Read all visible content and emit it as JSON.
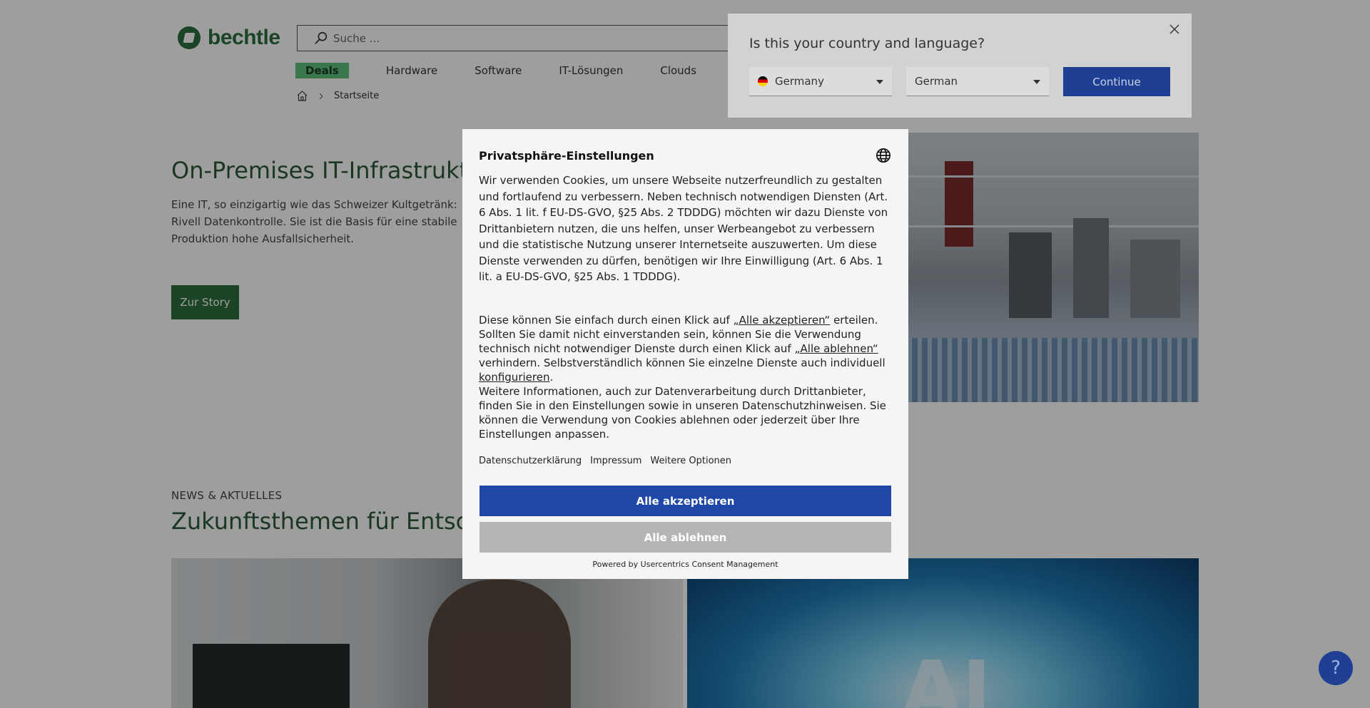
{
  "header": {
    "logo_text": "bechtle",
    "search_placeholder": "Suche ...",
    "nav": [
      "Deals",
      "Hardware",
      "Software",
      "IT-Lösungen",
      "Clouds"
    ],
    "breadcrumb": "Startseite"
  },
  "hero": {
    "title": "On-Premises IT-Infrastruktur",
    "text": "Eine IT, so einzigartig wie das Schweizer Kultgetränk: Rivell Datenkontrolle. Sie ist die Basis für eine stabile Produktion hohe Ausfallsicherheit.",
    "button": "Zur Story"
  },
  "news": {
    "kicker": "NEWS & AKTUELLES",
    "title": "Zukunftsthemen für Entsche"
  },
  "country_panel": {
    "question": "Is this your country and language?",
    "country": "Germany",
    "language": "German",
    "continue": "Continue"
  },
  "cookie": {
    "title": "Privatsphäre-Einstellungen",
    "p1": "Wir verwenden Cookies, um unsere Webseite nutzerfreundlich zu gestalten und fortlaufend zu verbessern. Neben technisch notwendigen Diensten (Art. 6 Abs. 1 lit. f EU-DS-GVO, §25 Abs. 2 TDDDG) möchten wir dazu Dienste von Drittanbietern nutzen, die uns helfen, unser Werbeangebot zu verbessern und die statistische Nutzung unserer Internetseite auszuwerten. Um diese Dienste verwenden zu dürfen, benötigen wir Ihre Einwilligung (Art. 6 Abs. 1 lit. a EU-DS-GVO, §25 Abs. 1 TDDDG).",
    "p2_a": "Diese können Sie einfach durch einen Klick auf ",
    "p2_link1": "„Alle akzeptieren“",
    "p2_b": " erteilen. Sollten Sie damit nicht einverstanden sein, können Sie die Verwendung technisch nicht notwendiger Dienste durch einen Klick auf ",
    "p2_link2": "„Alle ablehnen“",
    "p2_c": " verhindern. Selbstverständlich können Sie einzelne Dienste auch individuell ",
    "p2_link3": "konfigurieren",
    "p2_d": ".",
    "p3": "Weitere Informationen, auch zur Datenverarbeitung durch Drittanbieter, finden Sie in den Einstellungen sowie in unseren Datenschutzhinweisen. Sie können die Verwendung von Cookies ablehnen oder jederzeit über Ihre Einstellungen anpassen.",
    "links": [
      "Datenschutzerklärung",
      "Impressum",
      "Weitere Optionen"
    ],
    "accept": "Alle akzeptieren",
    "reject": "Alle ablehnen",
    "powered": "Powered by Usercentrics Consent Management"
  },
  "help_label": "?",
  "colors": {
    "brand_green": "#2c6e3f",
    "deals_green": "#5fc07c",
    "accept_blue": "#1e47a7",
    "continue_blue": "#1e3f94"
  }
}
